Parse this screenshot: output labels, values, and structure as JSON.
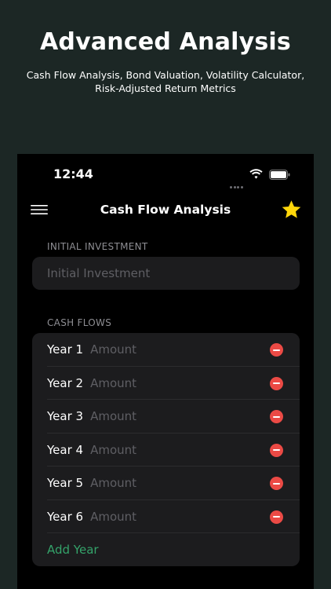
{
  "promo": {
    "title": "Advanced Analysis",
    "subtitle": "Cash Flow Analysis, Bond Valuation, Volatility Calculator, Risk-Adjusted Return Metrics"
  },
  "status_bar": {
    "time": "12:44",
    "icons": [
      "cellular-dots-icon",
      "wifi-icon",
      "battery-icon"
    ]
  },
  "nav": {
    "menu_icon": "hamburger-menu-icon",
    "title": "Cash Flow Analysis",
    "favorite_icon": "star-icon"
  },
  "initial_investment": {
    "section_label": "INITIAL INVESTMENT",
    "value": "",
    "placeholder": "Initial Investment"
  },
  "cash_flows": {
    "section_label": "CASH FLOWS",
    "rows": [
      {
        "year_label": "Year 1",
        "value": "",
        "placeholder": "Amount"
      },
      {
        "year_label": "Year 2",
        "value": "",
        "placeholder": "Amount"
      },
      {
        "year_label": "Year 3",
        "value": "",
        "placeholder": "Amount"
      },
      {
        "year_label": "Year 4",
        "value": "",
        "placeholder": "Amount"
      },
      {
        "year_label": "Year 5",
        "value": "",
        "placeholder": "Amount"
      },
      {
        "year_label": "Year 6",
        "value": "",
        "placeholder": "Amount"
      }
    ],
    "add_label": "Add Year"
  },
  "colors": {
    "background": "#1c2725",
    "screen": "#000000",
    "card": "#1c1c1e",
    "accent_green": "#34a36a",
    "remove_red": "#eb4a45",
    "star_yellow": "#ffd60a"
  }
}
